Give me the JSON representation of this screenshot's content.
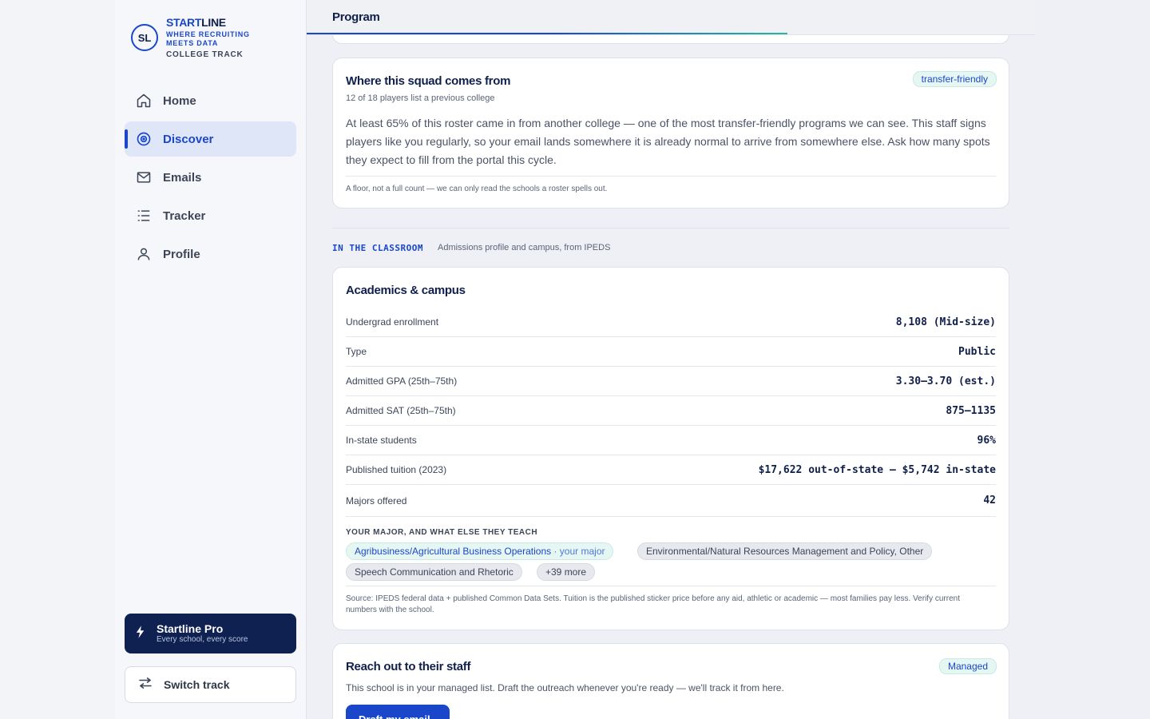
{
  "brand": {
    "logo_initials": "SL",
    "name_part1": "START",
    "name_part2": "LINE",
    "tagline": "WHERE RECRUITING MEETS DATA",
    "track": "COLLEGE TRACK"
  },
  "nav": {
    "items": [
      {
        "label": "Home",
        "icon": "home-icon"
      },
      {
        "label": "Discover",
        "icon": "target-icon",
        "active": true
      },
      {
        "label": "Emails",
        "icon": "mail-icon"
      },
      {
        "label": "Tracker",
        "icon": "list-icon"
      },
      {
        "label": "Profile",
        "icon": "user-icon"
      }
    ]
  },
  "pro": {
    "title": "Startline Pro",
    "subtitle": "Every school, every score",
    "icon": "bolt-icon"
  },
  "switch_track": {
    "label": "Switch track",
    "icon": "swap-arrows-icon"
  },
  "header": {
    "title": "Program",
    "progress": 0.66
  },
  "squad": {
    "title": "Where this squad comes from",
    "badge": "transfer-friendly",
    "subtitle": "12 of 18 players list a previous college",
    "body": "At least 65% of this roster came in from another college — one of the most transfer-friendly programs we can see. This staff signs players like you regularly, so your email lands somewhere it is already normal to arrive from somewhere else. Ask how many spots they expect to fill from the portal this cycle.",
    "footnote": "A floor, not a full count — we can only read the schools a roster spells out."
  },
  "classroom": {
    "kicker": "IN THE CLASSROOM",
    "description": "Admissions profile and campus, from IPEDS"
  },
  "academics": {
    "title": "Academics & campus",
    "rows": [
      {
        "label": "Undergrad enrollment",
        "value": "8,108 (Mid-size)"
      },
      {
        "label": "Type",
        "value": "Public"
      },
      {
        "label": "Admitted GPA (25th–75th)",
        "value": "3.30–3.70 (est.)"
      },
      {
        "label": "Admitted SAT (25th–75th)",
        "value": "875–1135"
      },
      {
        "label": "In-state students",
        "value": "96%"
      },
      {
        "label": "Published tuition (2023)",
        "value": "$17,622 out-of-state — $5,742 in-state"
      },
      {
        "label": "Majors offered",
        "value": "42"
      }
    ],
    "majors_label": "YOUR MAJOR, AND WHAT ELSE THEY TEACH",
    "majors": {
      "mine": "Agribusiness/Agricultural Business Operations",
      "mine_tag": "· your major",
      "others": [
        "Environmental/Natural Resources Management and Policy, Other",
        "Speech Communication and Rhetoric",
        "+39 more"
      ]
    },
    "source": "Source: IPEDS federal data + published Common Data Sets. Tuition is the published sticker price before any aid, athletic or academic — most families pay less. Verify current numbers with the school."
  },
  "reach": {
    "title": "Reach out to their staff",
    "badge": "Managed",
    "body": "This school is in your managed list. Draft the outreach whenever you're ready — we'll track it from here.",
    "button": "Draft my email"
  },
  "colors": {
    "accent": "#1a47c9",
    "navy": "#0f2150",
    "teal": "#2ab8a0",
    "badge_bg": "#e6f7f3"
  }
}
